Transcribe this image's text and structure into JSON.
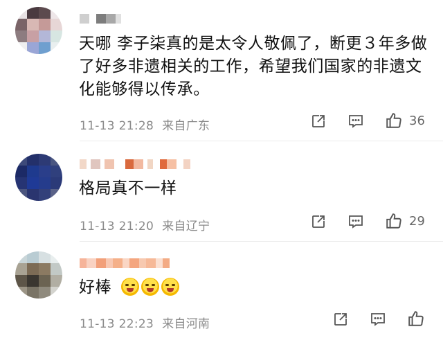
{
  "comments": [
    {
      "text": "天哪 李子柒真的是太令人敬佩了，断更３年多做了好多非遗相关的工作，希望我们国家的非遗文化能够得以传承。",
      "date": "11-13 21:28",
      "location": "来自广东",
      "likes": "36",
      "avatar_icon": "pixelated-avatar-icon"
    },
    {
      "text": "格局真不一样",
      "date": "11-13 21:20",
      "location": "来自辽宁",
      "likes": "29",
      "avatar_icon": "pixelated-avatar-icon"
    },
    {
      "text": "好棒",
      "date": "11-13 22:23",
      "location": "来自河南",
      "likes": "",
      "avatar_icon": "pixelated-avatar-icon",
      "emojis": [
        "crying-face-emoji",
        "crying-face-emoji",
        "crying-face-emoji"
      ]
    }
  ],
  "icons": {
    "share": "share-icon",
    "reply": "reply-icon",
    "like": "thumbs-up-icon"
  },
  "colors": {
    "meta_text": "#8a8a8a",
    "icon": "#666666",
    "divider": "#ececec"
  }
}
